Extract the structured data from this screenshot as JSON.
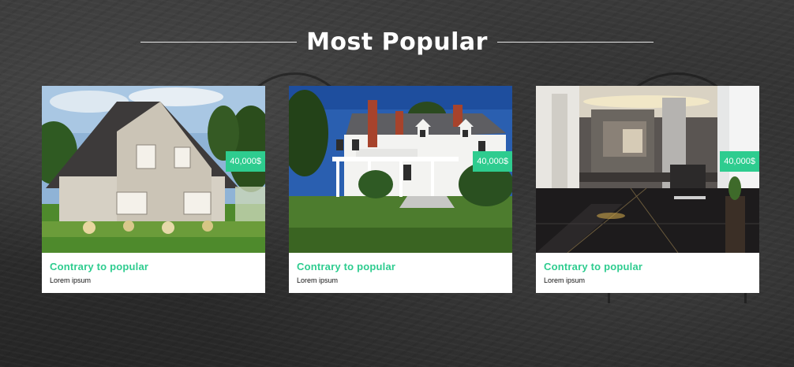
{
  "section": {
    "title": "Most Popular"
  },
  "listings": [
    {
      "title": "Contrary to popular",
      "subtitle": "Lorem ipsum",
      "price": "40,000$",
      "image": "suburban-house-photo"
    },
    {
      "title": "Contrary to popular",
      "subtitle": "Lorem ipsum",
      "price": "40,000$",
      "image": "colonial-house-photo"
    },
    {
      "title": "Contrary to popular",
      "subtitle": "Lorem ipsum",
      "price": "40,000$",
      "image": "modern-interior-photo"
    }
  ],
  "colors": {
    "accent": "#2ecc8f",
    "background": "#333333",
    "card": "#ffffff"
  }
}
